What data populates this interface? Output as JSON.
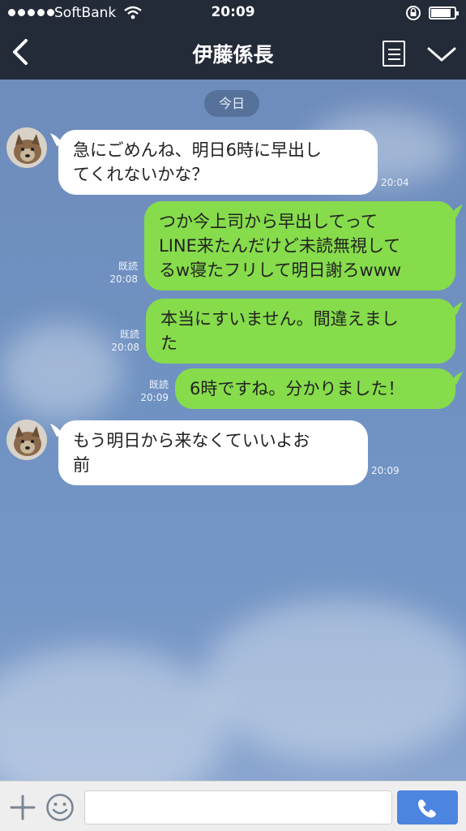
{
  "status_bar": {
    "carrier": "SoftBank",
    "time": "20:09",
    "signal_dots": 5,
    "battery_level_percent": 80
  },
  "header": {
    "title": "伊藤係長",
    "icons": [
      "back-arrow-icon",
      "note-menu-icon",
      "chevron-down-icon"
    ]
  },
  "chat": {
    "date_label": "今日",
    "messages": [
      {
        "side": "in",
        "lines": [
          "急にごめんね、明日6時に早出し",
          "てくれないかな？"
        ],
        "time": "20:04"
      },
      {
        "side": "out",
        "lines": [
          "つか今上司から早出してって",
          "LINE来たんだけど未読無視して",
          "るw寝たフリして明日謝ろwww"
        ],
        "read": "既読",
        "time": "20:08"
      },
      {
        "side": "out",
        "lines": [
          "本当にすいません。間違えまし",
          "た"
        ],
        "read": "既読",
        "time": "20:08"
      },
      {
        "side": "out",
        "lines": [
          "6時ですね。分かりました！"
        ],
        "read": "既読",
        "time": "20:09"
      },
      {
        "side": "in",
        "lines": [
          "もう明日から来なくていいよお",
          "前"
        ],
        "time": "20:09"
      }
    ]
  },
  "input_bar": {
    "placeholder": "",
    "icons": [
      "plus-icon",
      "emoji-icon",
      "phone-icon"
    ]
  },
  "colors": {
    "header_bg": "#232a38",
    "chat_bg": "#6e8cbc",
    "outgoing_bubble": "#86dc4b",
    "incoming_bubble": "#ffffff",
    "send_button": "#4b85e0"
  }
}
